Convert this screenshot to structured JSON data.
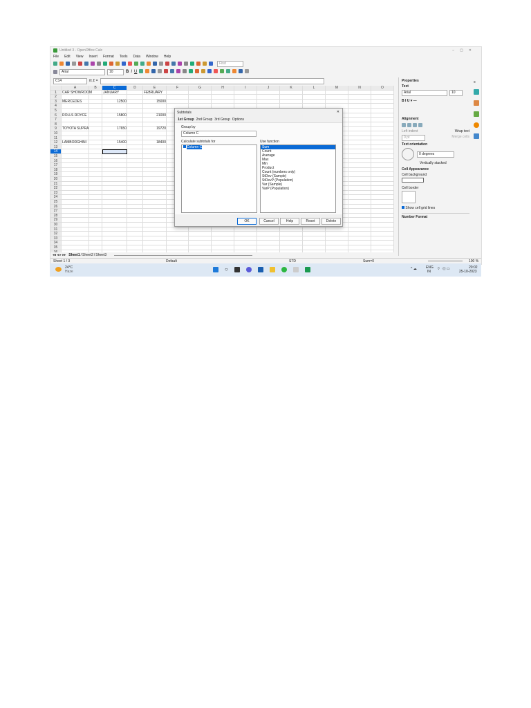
{
  "window": {
    "title": "Untitled 3 - OpenOffice Calc"
  },
  "menu": [
    "File",
    "Edit",
    "View",
    "Insert",
    "Format",
    "Tools",
    "Data",
    "Window",
    "Help"
  ],
  "toolbar": {
    "find_placeholder": "Find",
    "font": "Arial",
    "size": "10"
  },
  "formula_bar": {
    "cell_ref": "C14",
    "value": ""
  },
  "columns": [
    "A",
    "B",
    "C",
    "D",
    "E",
    "F",
    "G",
    "H",
    "I",
    "J",
    "K",
    "L",
    "M",
    "N",
    "O"
  ],
  "rows": 36,
  "cells": [
    {
      "r": 1,
      "c": 0,
      "v": "CAR SHOWROOM"
    },
    {
      "r": 1,
      "c": 2,
      "v": "JANUARY"
    },
    {
      "r": 1,
      "c": 4,
      "v": "FEBRUARY"
    },
    {
      "r": 3,
      "c": 0,
      "v": "MERCEDES"
    },
    {
      "r": 3,
      "c": 2,
      "v": "12500",
      "n": true
    },
    {
      "r": 3,
      "c": 4,
      "v": "15000",
      "n": true
    },
    {
      "r": 6,
      "c": 0,
      "v": "ROLLS ROYCE"
    },
    {
      "r": 6,
      "c": 2,
      "v": "15800",
      "n": true
    },
    {
      "r": 6,
      "c": 4,
      "v": "21000",
      "n": true
    },
    {
      "r": 9,
      "c": 0,
      "v": "TOYOTA SUPRA"
    },
    {
      "r": 9,
      "c": 2,
      "v": "17650",
      "n": true
    },
    {
      "r": 9,
      "c": 4,
      "v": "19720",
      "n": true
    },
    {
      "r": 12,
      "c": 0,
      "v": "LAMBORGHINI"
    },
    {
      "r": 12,
      "c": 2,
      "v": "15400",
      "n": true
    },
    {
      "r": 12,
      "c": 4,
      "v": "18400",
      "n": true
    }
  ],
  "dialog": {
    "title": "Subtotals",
    "tabs": [
      "1st Group",
      "2nd Group",
      "3rd Group",
      "Options"
    ],
    "group_by_label": "Group by",
    "group_by_value": "Column C",
    "calc_label": "Calculate subtotals for",
    "calc_items": [
      "Column C"
    ],
    "func_label": "Use function",
    "functions": [
      "Sum",
      "Count",
      "Average",
      "Max",
      "Min",
      "Product",
      "Count (numbers only)",
      "StDev (Sample)",
      "StDevP (Population)",
      "Var (Sample)",
      "VarP (Population)"
    ],
    "buttons": [
      "OK",
      "Cancel",
      "Help",
      "Reset",
      "Delete"
    ]
  },
  "sidebar": {
    "title": "Properties",
    "text_section": "Text",
    "font": "Arial",
    "size": "10",
    "alignment_section": "Alignment",
    "left_indent": "Left indent",
    "indent_value": "0 pt",
    "wrap_text": "Wrap text",
    "merge_cells": "Merge cells",
    "text_orientation": "Text orientation",
    "degrees": "0 degrees",
    "vertically_stacked": "Vertically stacked",
    "cell_appearance": "Cell Appearance",
    "cell_background": "Cell background",
    "cell_border": "Cell border",
    "show_grid": "Show cell grid lines",
    "number_format": "Number Format"
  },
  "sheet_tabs": [
    "Sheet1",
    "Sheet2",
    "Sheet3"
  ],
  "status": {
    "sheet": "Sheet 1 / 3",
    "style": "Default",
    "mode": "STD",
    "sum": "Sum=0",
    "zoom": "100 %"
  },
  "taskbar": {
    "temp": "24°C",
    "weather": "Haze",
    "lang1": "ENG",
    "lang2": "IN",
    "time": "20:02",
    "date": "25-10-2023"
  }
}
